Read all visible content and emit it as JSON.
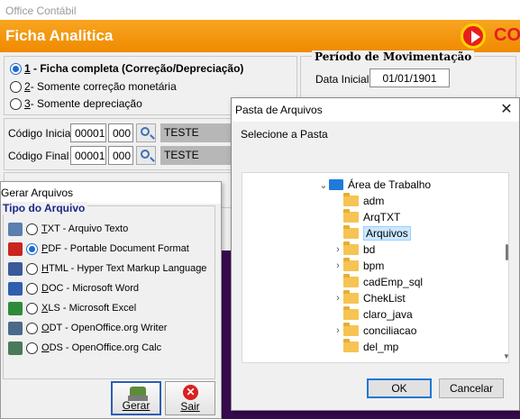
{
  "main": {
    "window_title": "Office Contábil",
    "header_title": "Ficha Analitica",
    "logo_text": "CO",
    "options": [
      {
        "number": "1",
        "label": " - Ficha completa (Correção/Depreciação)",
        "checked": true
      },
      {
        "number": "2",
        "label": "- Somente correção monetária",
        "checked": false
      },
      {
        "number": "3",
        "label": " - Somente depreciação",
        "checked": false
      }
    ],
    "periodo": {
      "title": "Período de Movimentação",
      "data_inicial_label": "Data Inicial",
      "data_inicial_value": "01/01/1901"
    },
    "codigos": {
      "inicial_label": "Código Inicial",
      "inicial_a": "00001",
      "inicial_b": "000",
      "inicial_desc": "TESTE",
      "final_label": "Código Final",
      "final_a": "00001",
      "final_b": "000",
      "final_desc": "TESTE"
    }
  },
  "gerar": {
    "title": "Gerar Arquivos",
    "group_title": "Tipo do Arquivo",
    "formats": [
      {
        "key": "T",
        "rest": "XT - Arquivo Texto",
        "icon": "txt-file-icon",
        "color": "#5a7fb0",
        "checked": false
      },
      {
        "key": "P",
        "rest": "DF - Portable Document Format",
        "icon": "pdf-file-icon",
        "color": "#c8261e",
        "checked": true
      },
      {
        "key": "H",
        "rest": "TML - Hyper Text Markup Language",
        "icon": "html-file-icon",
        "color": "#3a5a9a",
        "checked": false
      },
      {
        "key": "D",
        "rest": "OC - Microsoft Word",
        "icon": "doc-file-icon",
        "color": "#2f5fae",
        "checked": false
      },
      {
        "key": "X",
        "rest": "LS - Microsoft Excel",
        "icon": "xls-file-icon",
        "color": "#2e8b3a",
        "checked": false
      },
      {
        "key": "O",
        "rest": "DT - OpenOffice.org Writer",
        "icon": "odt-file-icon",
        "color": "#4a6a8a",
        "checked": false
      },
      {
        "key": "O",
        "rest": "DS - OpenOffice.org Calc",
        "icon": "ods-file-icon",
        "color": "#4a7a5a",
        "checked": false
      }
    ],
    "gerar_label": "Gerar",
    "sair_label": "Sair"
  },
  "pasta": {
    "title": "Pasta de Arquivos",
    "instruction": "Selecione a Pasta",
    "root": "Área de Trabalho",
    "folders": [
      {
        "name": "adm",
        "expandable": false,
        "selected": false
      },
      {
        "name": "ArqTXT",
        "expandable": false,
        "selected": false
      },
      {
        "name": "Arquivos",
        "expandable": false,
        "selected": true
      },
      {
        "name": "bd",
        "expandable": true,
        "selected": false
      },
      {
        "name": "bpm",
        "expandable": true,
        "selected": false
      },
      {
        "name": "cadEmp_sql",
        "expandable": false,
        "selected": false
      },
      {
        "name": "ChekList",
        "expandable": true,
        "selected": false
      },
      {
        "name": "claro_java",
        "expandable": false,
        "selected": false
      },
      {
        "name": "conciliacao",
        "expandable": true,
        "selected": false
      },
      {
        "name": "del_mp",
        "expandable": false,
        "selected": false
      }
    ],
    "ok_label": "OK",
    "cancel_label": "Cancelar"
  }
}
